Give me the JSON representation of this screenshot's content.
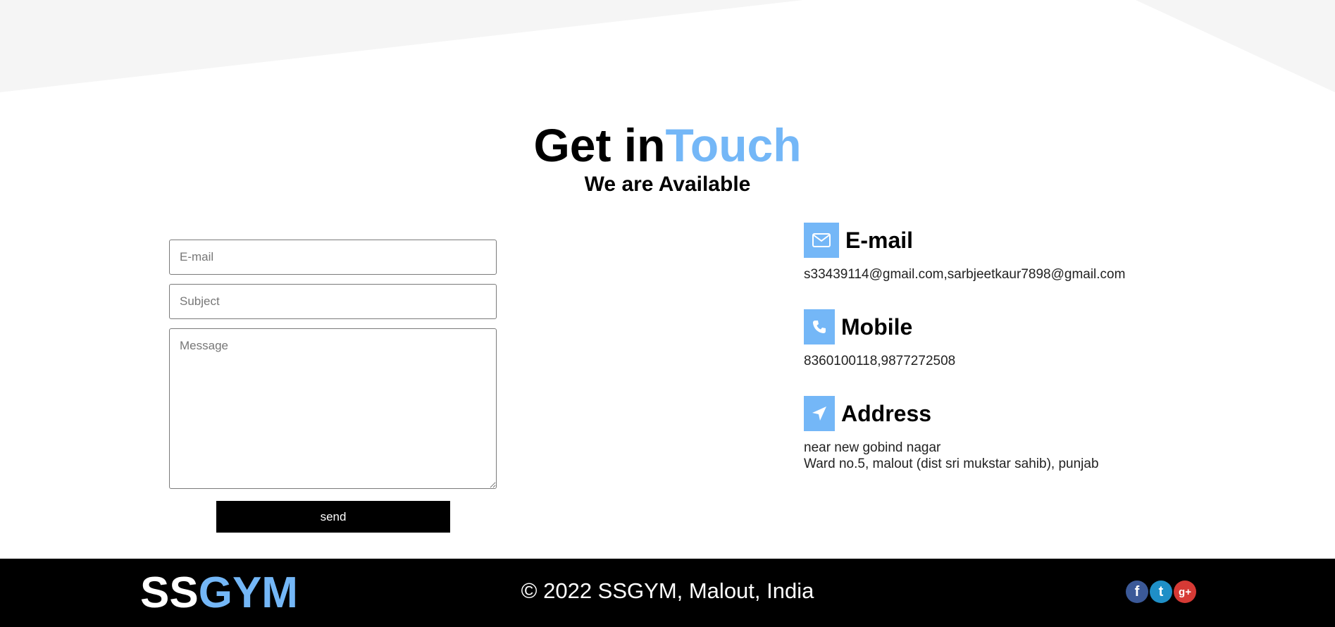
{
  "heading": {
    "title_main": "Get in",
    "title_accent": "Touch",
    "subtitle": "We are Available"
  },
  "form": {
    "email_placeholder": "E-mail",
    "subject_placeholder": "Subject",
    "message_placeholder": "Message",
    "send_label": "send"
  },
  "contact": {
    "email": {
      "title": "E-mail",
      "text": "s33439114@gmail.com,sarbjeetkaur7898@gmail.com",
      "icon": "envelope-icon"
    },
    "mobile": {
      "title": "Mobile",
      "text": "8360100118,9877272508",
      "icon": "phone-icon"
    },
    "address": {
      "title": "Address",
      "line1": "near new gobind nagar",
      "line2": "Ward no.5, malout (dist sri mukstar sahib), punjab",
      "icon": "location-arrow-icon"
    }
  },
  "footer": {
    "logo_main": "SS",
    "logo_accent": "GYM",
    "copyright": "© 2022 SSGYM, Malout, India",
    "socials": [
      {
        "name": "facebook-icon",
        "glyph": "f"
      },
      {
        "name": "twitter-icon",
        "glyph": "t"
      },
      {
        "name": "google-plus-icon",
        "glyph": "g+"
      }
    ]
  },
  "colors": {
    "accent": "#74b7f7",
    "footer_bg": "#000000",
    "background_shape": "#f5f5f5"
  }
}
